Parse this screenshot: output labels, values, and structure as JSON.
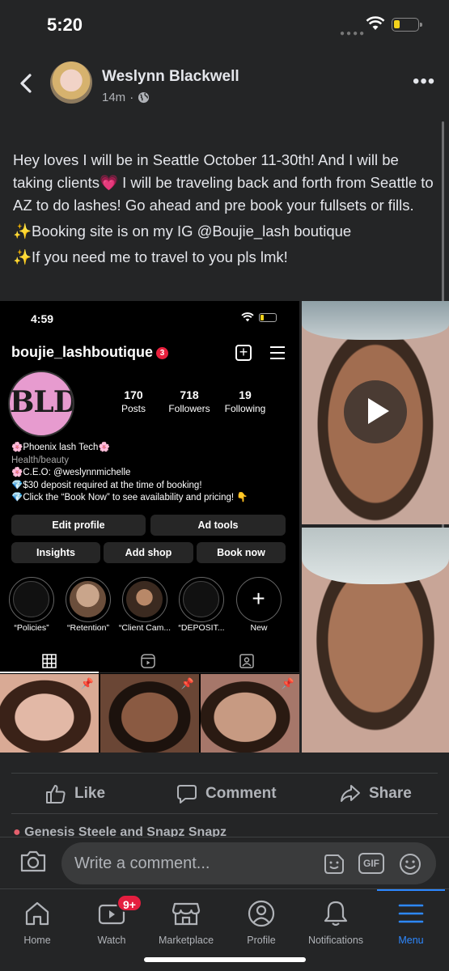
{
  "status": {
    "time": "5:20"
  },
  "post": {
    "author": "Weslynn Blackwell",
    "time": "14m",
    "paragraphs": [
      "Hey loves I will be in Seattle October 11-30th! And I will be taking clients💗 I will be traveling back and forth from Seattle to AZ to do lashes! Go ahead and pre book your fullsets or fills.",
      "✨Booking site is on my IG @Boujie_lash boutique",
      "✨If you need me to travel to you pls lmk!"
    ]
  },
  "instagram": {
    "time": "4:59",
    "username": "boujie_lashboutique",
    "badge": "3",
    "logo_text": "BLD",
    "stats": [
      {
        "value": "170",
        "label": "Posts"
      },
      {
        "value": "718",
        "label": "Followers"
      },
      {
        "value": "19",
        "label": "Following"
      }
    ],
    "bio": [
      "🌸Phoenix lash Tech🌸",
      "Health/beauty",
      "🌸C.E.O: @weslynnmichelle",
      "💎$30 deposit required at the time of booking!",
      "💎Click the “Book Now” to see availability and pricing! 👇"
    ],
    "buttons_row1": [
      "Edit profile",
      "Ad tools"
    ],
    "buttons_row2": [
      "Insights",
      "Add shop",
      "Book now"
    ],
    "highlights": [
      "“Policies”",
      "“Retention”",
      "“Client Cam...",
      "“DEPOSIT...",
      "New"
    ]
  },
  "actions": {
    "like": "Like",
    "comment": "Comment",
    "share": "Share"
  },
  "next_comment": "Genesis Steele and Snapz Snapz",
  "comment_bar": {
    "placeholder": "Write a comment..."
  },
  "tabs": [
    {
      "label": "Home",
      "icon": "home-icon"
    },
    {
      "label": "Watch",
      "icon": "watch-icon",
      "badge": "9+"
    },
    {
      "label": "Marketplace",
      "icon": "marketplace-icon"
    },
    {
      "label": "Profile",
      "icon": "profile-icon"
    },
    {
      "label": "Notifications",
      "icon": "bell-icon"
    },
    {
      "label": "Menu",
      "icon": "menu-icon",
      "active": true
    }
  ],
  "colors": {
    "accent": "#2d88ff",
    "badge": "#e41e3f",
    "background": "#242526"
  }
}
